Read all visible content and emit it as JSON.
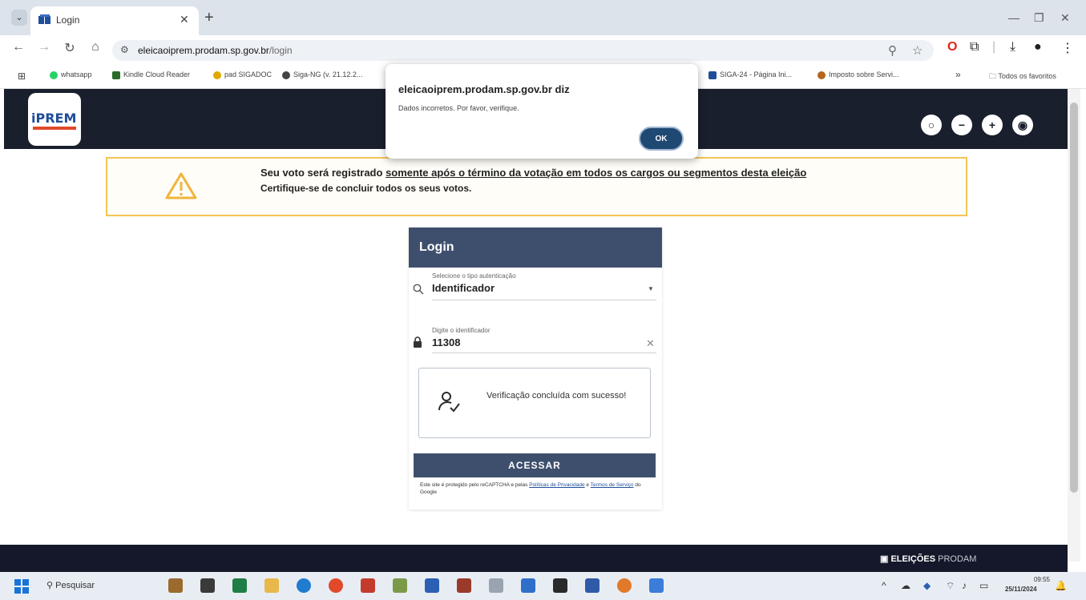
{
  "browser": {
    "tab_title": "Login",
    "url_host": "eleicaoiprem.prodam.sp.gov.br",
    "url_path": "/login",
    "bookmarks": [
      {
        "label": "whatsapp",
        "color": "#25d366"
      },
      {
        "label": "Kindle Cloud Reader",
        "color": "#2a6b2a"
      },
      {
        "label": "pad SIGADOC",
        "color": "#e0a800"
      },
      {
        "label": "Siga-NG (v. 21.12.2...",
        "color": "#444444"
      },
      {
        "label": "SIGA-24 - Página Ini...",
        "color": "#1f4e9a"
      },
      {
        "label": "Imposto sobre Servi...",
        "color": "#b5651d"
      }
    ],
    "bookmarks_overflow": "»",
    "all_bookmarks": "Todos os favoritos"
  },
  "alert": {
    "title": "eleicaoiprem.prodam.sp.gov.br diz",
    "message": "Dados incorretos. Por favor, verifique.",
    "ok_label": "OK"
  },
  "header": {
    "logo_text": "iPREM"
  },
  "warning": {
    "line1_a": "Seu voto será registrado ",
    "line1_b": "somente após o término da votação em todos os cargos ou segmentos desta eleição",
    "line2": "Certifique-se de concluir todos os seus votos."
  },
  "login": {
    "title": "Login",
    "auth_label": "Selecione o tipo autenticação",
    "auth_value": "Identificador",
    "id_label": "Digite o identificador",
    "id_value": "11308",
    "captcha_text": "Verificação concluída com sucesso!",
    "submit_label": "ACESSAR",
    "recaptcha_a": "Este site é protegido pelo reCAPTCHA e pelas ",
    "recaptcha_privacy": "Políticas de Privacidade",
    "recaptcha_b": " e ",
    "recaptcha_terms": "Termos de Serviço",
    "recaptcha_c": " do Google"
  },
  "footer": {
    "brand_bold": "ELEIÇÕES",
    "brand_thin": "PRODAM"
  },
  "taskbar": {
    "search_placeholder": "Pesquisar",
    "time": "09:55",
    "date": "25/11/2024"
  },
  "colors": {
    "header_bg": "#1a1f2e",
    "card_header": "#3e4f6e",
    "warning_border": "#f4c553",
    "alert_ok": "#1f4873"
  }
}
